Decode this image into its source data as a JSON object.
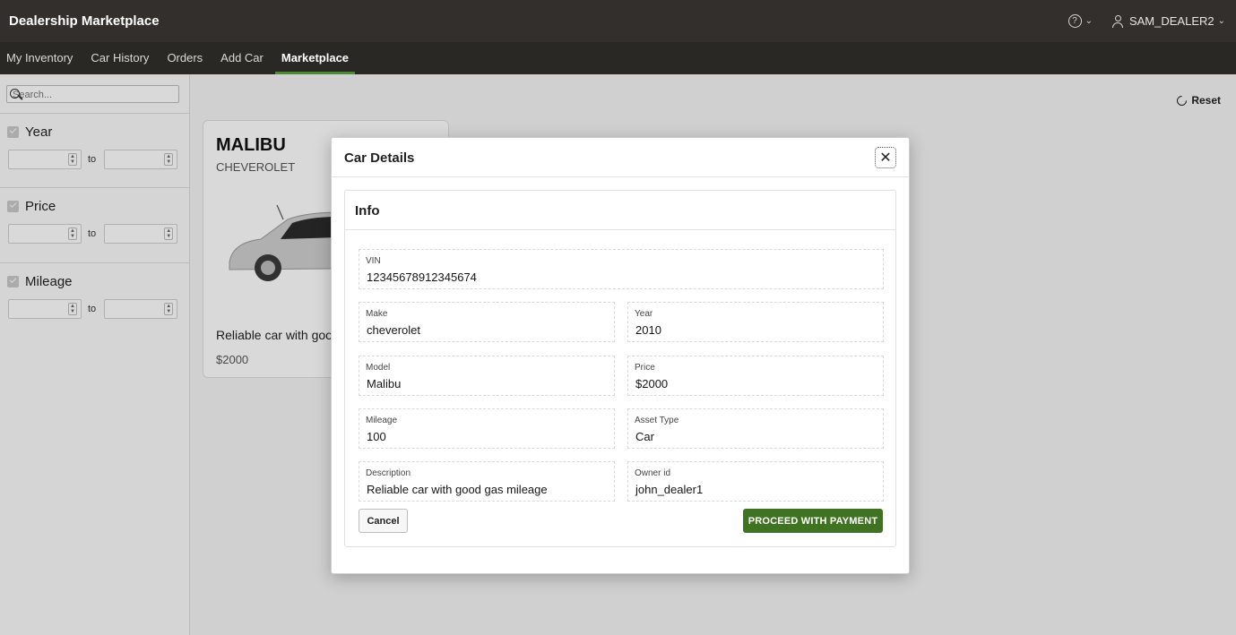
{
  "header": {
    "title": "Dealership Marketplace",
    "username": "SAM_DEALER2"
  },
  "nav": {
    "tabs": [
      "My Inventory",
      "Car History",
      "Orders",
      "Add Car",
      "Marketplace"
    ]
  },
  "sidebar": {
    "search_placeholder": "Search...",
    "facets": [
      {
        "label": "Year",
        "to": "to"
      },
      {
        "label": "Price",
        "to": "to"
      },
      {
        "label": "Mileage",
        "to": "to"
      }
    ]
  },
  "main": {
    "reset_label": "Reset",
    "card": {
      "title": "MALIBU",
      "subtitle": "CHEVEROLET",
      "description": "Reliable car with goo",
      "price": "$2000"
    }
  },
  "dialog": {
    "title": "Car Details",
    "region_title": "Info",
    "fields": {
      "vin": {
        "label": "VIN",
        "value": "12345678912345674"
      },
      "make": {
        "label": "Make",
        "value": "cheverolet"
      },
      "year": {
        "label": "Year",
        "value": "2010"
      },
      "model": {
        "label": "Model",
        "value": "Malibu"
      },
      "price": {
        "label": "Price",
        "value": "$2000"
      },
      "mileage": {
        "label": "Mileage",
        "value": "100"
      },
      "asset_type": {
        "label": "Asset Type",
        "value": "Car"
      },
      "description": {
        "label": "Description",
        "value": "Reliable car with good gas mileage"
      },
      "owner": {
        "label": "Owner id",
        "value": "john_dealer1"
      }
    },
    "cancel_label": "Cancel",
    "pay_label": "PROCEED WITH PAYMENT"
  },
  "colors": {
    "header_bg": "#322f2c",
    "nav_bg": "#2a2825",
    "accent": "#4c8a33",
    "primary_button": "#3f7321"
  }
}
